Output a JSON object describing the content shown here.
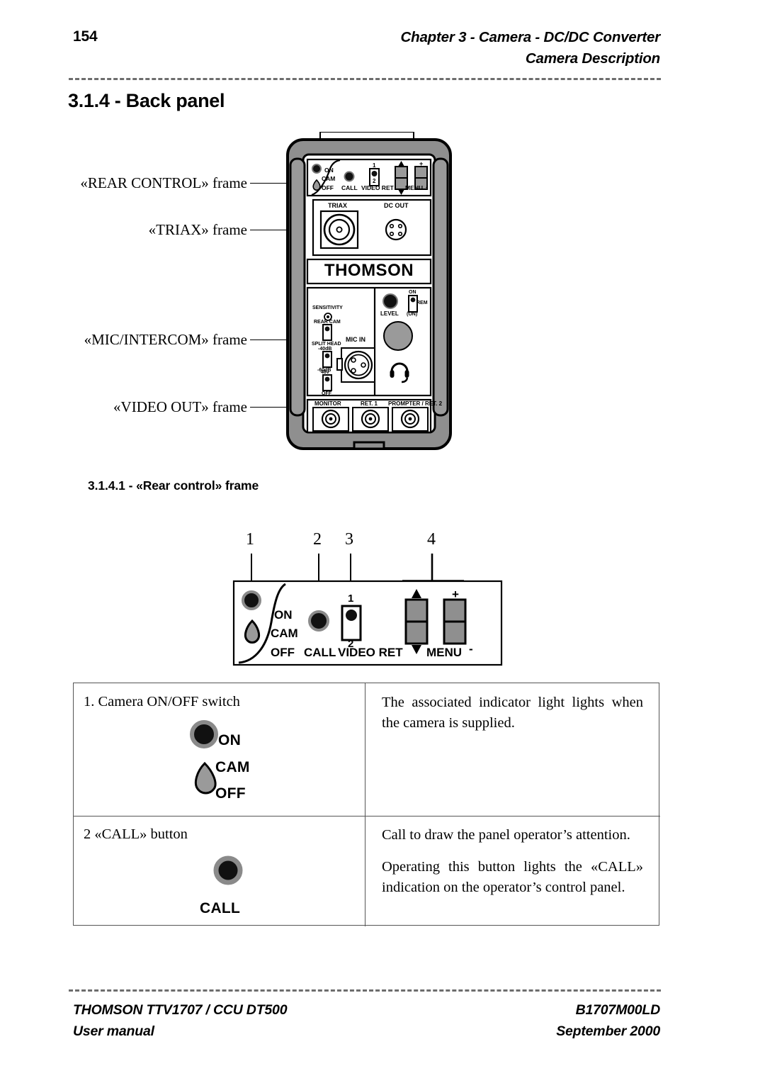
{
  "header": {
    "page_number": "154",
    "chapter_line": "Chapter 3 - Camera - DC/DC Converter",
    "subtitle_line": "Camera Description"
  },
  "headings": {
    "back_panel": "3.1.4 - Back panel",
    "rear_control": "3.1.4.1 - «Rear control» frame"
  },
  "figure_back_panel": {
    "labels": [
      {
        "text": "«REAR CONTROL» frame"
      },
      {
        "text": "«TRIAX» frame"
      },
      {
        "text": "«MIC/INTERCOM» frame"
      },
      {
        "text": "«VIDEO OUT» frame"
      }
    ],
    "brand": "THOMSON",
    "rear_control_frame": {
      "on": "ON",
      "cam": "CAM",
      "off": "OFF",
      "call": "CALL",
      "video_ret": "VIDEO RET",
      "video_ret_pos_1": "1",
      "video_ret_pos_2": "2",
      "menu": "MENU",
      "plus": "+",
      "minus": "-"
    },
    "triax_frame": {
      "triax": "TRIAX",
      "dc_out": "DC OUT"
    },
    "mic_intercom_frame": {
      "sensitivity": "SENSITIVITY",
      "rear_cam": "REAR CAM",
      "split_head": "SPLIT HEAD",
      "gain_40": "-40dB",
      "gain_60": "-60dB",
      "phantom_48v": "48v",
      "phantom_off": "OFF",
      "mic_in": "MIC IN",
      "level": "LEVEL",
      "intercom_on": "ON",
      "intercom_rem": "REM",
      "intercom_on_paren": "(ON)"
    },
    "video_out_frame": {
      "monitor": "MONITOR",
      "ret_1": "RET. 1",
      "prompter_ret_2": "PROMPTER / RET. 2"
    }
  },
  "figure_rear_control": {
    "callouts": [
      "1",
      "2",
      "3",
      "4"
    ],
    "labels": {
      "on": "ON",
      "cam": "CAM",
      "off": "OFF",
      "call": "CALL",
      "video_ret": "VIDEO RET",
      "video_ret_pos_1": "1",
      "video_ret_pos_2": "2",
      "menu": "MENU",
      "plus": "+",
      "minus": "-"
    }
  },
  "table": {
    "rows": [
      {
        "item_label": "1. Camera ON/OFF switch",
        "switch_positions": [
          "ON",
          "CAM",
          "OFF"
        ],
        "description": [
          "The associated indicator light lights when the camera is supplied."
        ]
      },
      {
        "item_label": "2   «CALL» button",
        "button_label": "CALL",
        "description": [
          "Call to draw the panel operator’s attention.",
          "Operating this button lights the «CALL» indication on the operator’s control panel."
        ]
      }
    ]
  },
  "footer": {
    "left_line1": "THOMSON TTV1707 / CCU DT500",
    "left_line2": "User manual",
    "right_line1": "B1707M00LD",
    "right_line2": "September 2000"
  },
  "colors": {
    "ink": "#000000",
    "rule": "#6d6d6d",
    "table_border": "#555555",
    "body_gray": "#8f8f8f",
    "panel_gray": "#9a9a9a"
  }
}
